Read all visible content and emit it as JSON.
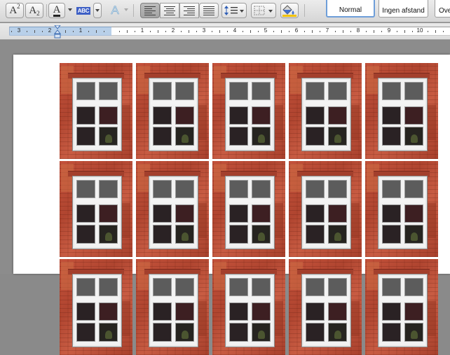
{
  "toolbar": {
    "superscript_label": "A",
    "superscript_mark": "2",
    "subscript_label": "A",
    "subscript_mark": "2",
    "font_color_label": "A",
    "highlight_label": "ABC",
    "text_effects_label": "A",
    "style_quick": [
      "Normal",
      "Ingen afstand",
      "Ove"
    ]
  },
  "ruler": {
    "numbers_left": [
      "3",
      "2",
      "1"
    ],
    "numbers_right": [
      "1",
      "2",
      "3",
      "4",
      "5",
      "6",
      "7",
      "8",
      "9",
      "10"
    ]
  },
  "document": {
    "image_rows": 3,
    "image_columns": 5
  },
  "colors": {
    "brick": "#b84a33",
    "selection_blue": "#6e9ed9",
    "ruler_margin": "#b9d0e9"
  }
}
